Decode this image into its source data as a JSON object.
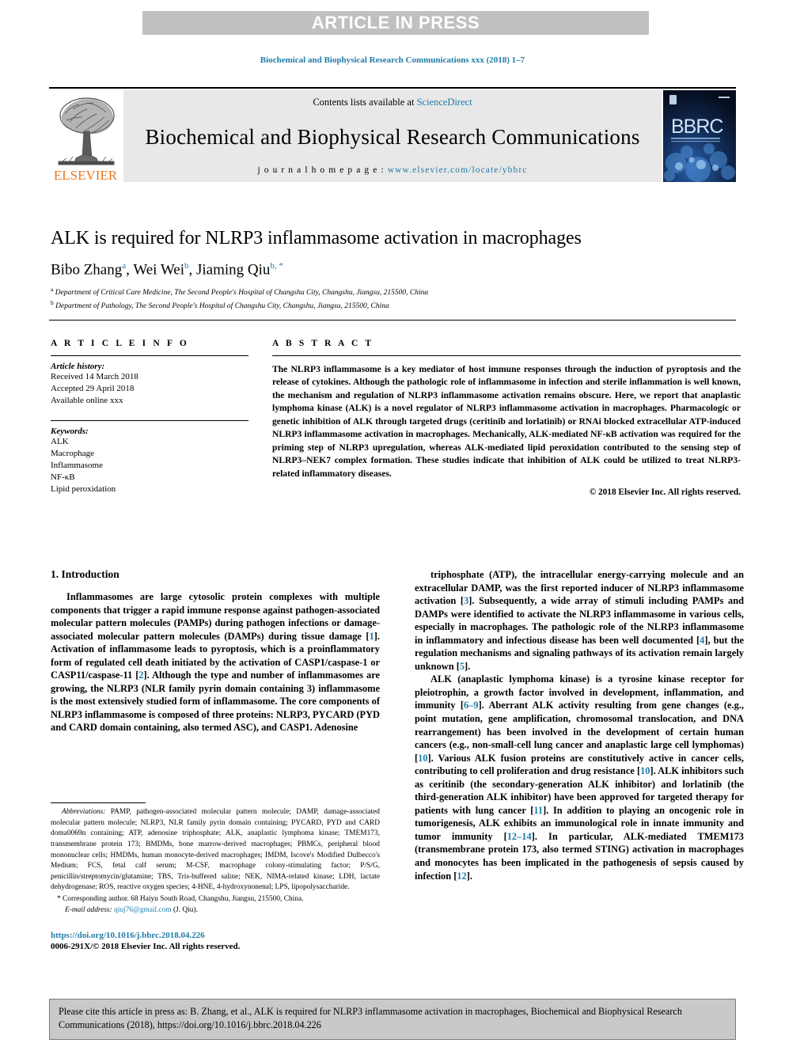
{
  "banner": {
    "text": "ARTICLE IN PRESS"
  },
  "journal_ref": "Biochemical and Biophysical Research Communications xxx (2018) 1–7",
  "masthead": {
    "publisher": "ELSEVIER",
    "contents_prefix": "Contents lists available at ",
    "contents_link": "ScienceDirect",
    "journal_title": "Biochemical and Biophysical Research Communications",
    "homepage_prefix": "j o u r n a l   h o m e p a g e :  ",
    "homepage_url": "www.elsevier.com/locate/ybbrc",
    "cover_label": "BBRC"
  },
  "article": {
    "title": "ALK is required for NLRP3 inflammasome activation in macrophages",
    "authors_plain": "Bibo Zhang a, Wei Wei b, Jiaming Qiu b, *",
    "authors": [
      {
        "name": "Bibo Zhang",
        "sup": "a"
      },
      {
        "name": "Wei Wei",
        "sup": "b"
      },
      {
        "name": "Jiaming Qiu",
        "sup": "b, *"
      }
    ],
    "affiliations": [
      {
        "sup": "a",
        "text": "Department of Critical Care Medicine, The Second People's Hospital of Changshu City, Changshu, Jiangsu, 215500, China"
      },
      {
        "sup": "b",
        "text": "Department of Pathology, The Second People's Hospital of Changshu City, Changshu, Jiangsu, 215500, China"
      }
    ]
  },
  "info": {
    "heading": "A R T I C L E   I N F O",
    "history_label": "Article history:",
    "history": [
      "Received 14 March 2018",
      "Accepted 29 April 2018",
      "Available online xxx"
    ],
    "keywords_label": "Keywords:",
    "keywords": [
      "ALK",
      "Macrophage",
      "Inflammasome",
      "NF-κB",
      "Lipid peroxidation"
    ]
  },
  "abstract": {
    "heading": "A B S T R A C T",
    "body": "The NLRP3 inflammasome is a key mediator of host immune responses through the induction of pyroptosis and the release of cytokines. Although the pathologic role of inflammasome in infection and sterile inflammation is well known, the mechanism and regulation of NLRP3 inflammasome activation remains obscure. Here, we report that anaplastic lymphoma kinase (ALK) is a novel regulator of NLRP3 inflammasome activation in macrophages. Pharmacologic or genetic inhibition of ALK through targeted drugs (ceritinib and lorlatinib) or RNAi blocked extracellular ATP-induced NLRP3 inflammasome activation in macrophages. Mechanically, ALK-mediated NF-κB activation was required for the priming step of NLRP3 upregulation, whereas ALK-mediated lipid peroxidation contributed to the sensing step of NLRP3–NEK7 complex formation. These studies indicate that inhibition of ALK could be utilized to treat NLRP3-related inflammatory diseases.",
    "copyright": "© 2018 Elsevier Inc. All rights reserved."
  },
  "introduction": {
    "heading": "1. Introduction",
    "left_paragraph_1": "Inflammasomes are large cytosolic protein complexes with multiple components that trigger a rapid immune response against pathogen-associated molecular pattern molecules (PAMPs) during pathogen infections or damage-associated molecular pattern molecules (DAMPs) during tissue damage [1]. Activation of inflammasome leads to pyroptosis, which is a proinflammatory form of regulated cell death initiated by the activation of CASP1/caspase-1 or CASP11/caspase-11 [2]. Although the type and number of inflammasomes are growing, the NLRP3 (NLR family pyrin domain containing 3) inflammasome is the most extensively studied form of inflammasome. The core components of NLRP3 inflammasome is composed of three proteins: NLRP3, PYCARD (PYD and CARD domain containing, also termed ASC), and CASP1. Adenosine",
    "right_paragraph_1": "triphosphate (ATP), the intracellular energy-carrying molecule and an extracellular DAMP, was the first reported inducer of NLRP3 inflammasome activation [3]. Subsequently, a wide array of stimuli including PAMPs and DAMPs were identified to activate the NLRP3 inflammasome in various cells, especially in macrophages. The pathologic role of the NLRP3 inflammasome in inflammatory and infectious disease has been well documented [4], but the regulation mechanisms and signaling pathways of its activation remain largely unknown [5].",
    "right_paragraph_2": "ALK (anaplastic lymphoma kinase) is a tyrosine kinase receptor for pleiotrophin, a growth factor involved in development, inflammation, and immunity [6–9]. Aberrant ALK activity resulting from gene changes (e.g., point mutation, gene amplification, chromosomal translocation, and DNA rearrangement) has been involved in the development of certain human cancers (e.g., non-small-cell lung cancer and anaplastic large cell lymphomas) [10]. Various ALK fusion proteins are constitutively active in cancer cells, contributing to cell proliferation and drug resistance [10]. ALK inhibitors such as ceritinib (the secondary-generation ALK inhibitor) and lorlatinib (the third-generation ALK inhibitor) have been approved for targeted therapy for patients with lung cancer [11]. In addition to playing an oncogenic role in tumorigenesis, ALK exhibits an immunological role in innate immunity and tumor immunity [12–14]. In particular, ALK-mediated TMEM173 (transmembrane protein 173, also termed STING) activation in macrophages and monocytes has been implicated in the pathogenesis of sepsis caused by infection [12]."
  },
  "footnote": {
    "abbrev_label": "Abbreviations:",
    "abbrev_text": " PAMP, pathogen-associated molecular pattern molecule; DAMP, damage-associated molecular pattern molecule; NLRP3, NLR family pyrin domain containing; PYCARD, PYD and CARD doma0069n containing; ATP, adenosine triphosphate; ALK, anaplastic lymphoma kinase; TMEM173, transmembrane protein 173; BMDMs, bone marrow-derived macrophages; PBMCs, peripheral blood mononuclear cells; HMDMs, human monocyte-derived macrophages; IMDM, Iscove's Modified Dulbecco's Medium; FCS, fetal calf serum; M-CSF, macrophage colony-stimulating factor; P/S/G, penicillin/streptomycin/glutamine; TBS, Tris-buffered saline; NEK, NIMA-related kinase; LDH, lactate dehydrogenase; ROS, reactive oxygen species; 4-HNE, 4-hydroxynonenal; LPS, lipopolysaccharide.",
    "corresponding_marker": "*",
    "corresponding_text": " Corresponding author. 68 Haiyu South Road, Changshu, Jiangsu, 215500, China.",
    "email_label": "E-mail address:",
    "email": "qiuj76@gmail.com",
    "email_suffix": " (J. Qiu).",
    "doi": "https://doi.org/10.1016/j.bbrc.2018.04.226",
    "issn_line": "0006-291X/© 2018 Elsevier Inc. All rights reserved."
  },
  "cite_box": {
    "text": "Please cite this article in press as: B. Zhang, et al., ALK is required for NLRP3 inflammasome activation in macrophages, Biochemical and Biophysical Research Communications (2018), https://doi.org/10.1016/j.bbrc.2018.04.226"
  },
  "colors": {
    "link": "#1f7ba8",
    "banner_bg": "#c0c0c0",
    "masthead_bg": "#e8e8e8",
    "elsevier_orange": "#e87722",
    "cite_bg": "#c9c9c9"
  }
}
